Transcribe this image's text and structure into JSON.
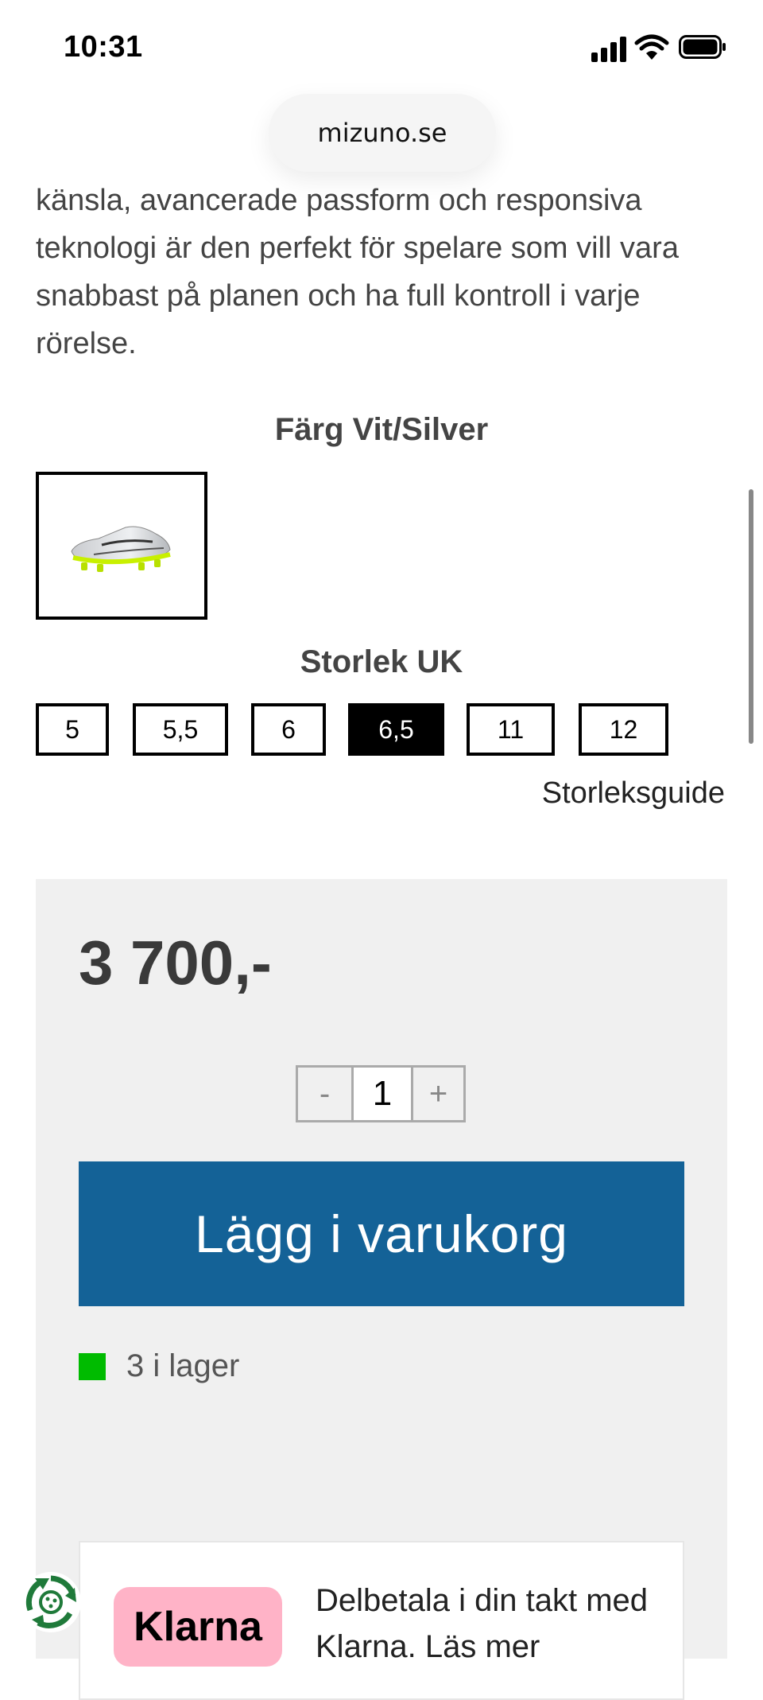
{
  "status_bar": {
    "time": "10:31"
  },
  "browser": {
    "url": "mizuno.se"
  },
  "product": {
    "description": "känsla, avancerade passform och responsiva teknologi är den perfekt för spelare som vill vara snabbast på planen och ha full kontroll i varje rörelse.",
    "color_label": "Färg",
    "color_value": "Vit/Silver",
    "size_label": "Storlek UK",
    "sizes": [
      "5",
      "5,5",
      "6",
      "6,5",
      "11",
      "12"
    ],
    "selected_size": "6,5",
    "size_guide": "Storleksguide",
    "price": "3 700,-",
    "quantity": "1",
    "qty_minus": "-",
    "qty_plus": "+",
    "add_to_cart": "Lägg i varukorg",
    "stock": "3 i lager"
  },
  "klarna": {
    "logo": "Klarna",
    "text": "Delbetala i din takt med Klarna. Läs mer"
  },
  "colors": {
    "cart_button": "#146297",
    "stock_indicator": "#00bb00",
    "klarna_pink": "#ffb3c7",
    "panel_bg": "#f0f0f0"
  },
  "icons": [
    "signal-icon",
    "wifi-icon",
    "battery-icon",
    "recycle-icon"
  ]
}
